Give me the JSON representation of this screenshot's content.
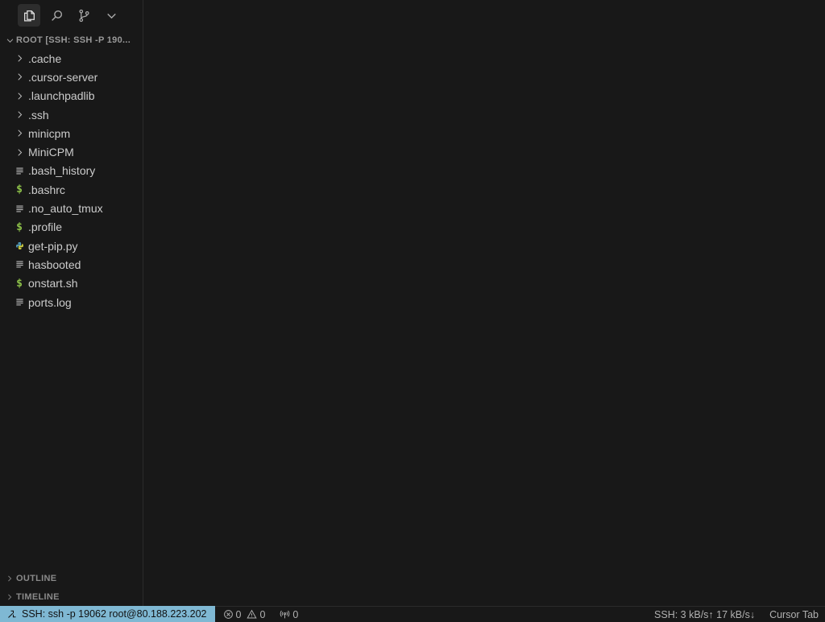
{
  "sidebar": {
    "tabs": [
      {
        "name": "explorer",
        "icon": "files-icon",
        "active": true
      },
      {
        "name": "search",
        "icon": "search-icon",
        "active": false
      },
      {
        "name": "source-control",
        "icon": "source-control-icon",
        "active": false
      },
      {
        "name": "more",
        "icon": "chevron-down-icon",
        "active": false
      }
    ],
    "root_label": "ROOT [SSH: SSH -P 190...",
    "tree": [
      {
        "label": ".cache",
        "type": "folder",
        "icon": "chevron-right-icon"
      },
      {
        "label": ".cursor-server",
        "type": "folder",
        "icon": "chevron-right-icon"
      },
      {
        "label": ".launchpadlib",
        "type": "folder",
        "icon": "chevron-right-icon"
      },
      {
        "label": ".ssh",
        "type": "folder",
        "icon": "chevron-right-icon"
      },
      {
        "label": "minicpm",
        "type": "folder",
        "icon": "chevron-right-icon"
      },
      {
        "label": "MiniCPM",
        "type": "folder",
        "icon": "chevron-right-icon"
      },
      {
        "label": ".bash_history",
        "type": "file",
        "icon": "text-file-icon"
      },
      {
        "label": ".bashrc",
        "type": "file",
        "icon": "shell-file-icon"
      },
      {
        "label": ".no_auto_tmux",
        "type": "file",
        "icon": "text-file-icon"
      },
      {
        "label": ".profile",
        "type": "file",
        "icon": "shell-file-icon"
      },
      {
        "label": "get-pip.py",
        "type": "file",
        "icon": "python-file-icon"
      },
      {
        "label": "hasbooted",
        "type": "file",
        "icon": "text-file-icon"
      },
      {
        "label": "onstart.sh",
        "type": "file",
        "icon": "shell-file-icon"
      },
      {
        "label": "ports.log",
        "type": "file",
        "icon": "text-file-icon"
      }
    ],
    "panels": {
      "outline": "OUTLINE",
      "timeline": "TIMELINE"
    }
  },
  "statusbar": {
    "remote": "SSH: ssh -p 19062 root@80.188.223.202",
    "errors": "0",
    "warnings": "0",
    "ports": "0",
    "ssh_traffic": "SSH: 3 kB/s↑ 17 kB/s↓",
    "cursor_tab": "Cursor Tab"
  },
  "colors": {
    "background": "#181818",
    "remote_indicator_bg": "#7fb8d3",
    "shell_icon": "#8dc149",
    "python_icon_blue": "#519aba",
    "python_icon_yellow": "#cbcb41"
  }
}
